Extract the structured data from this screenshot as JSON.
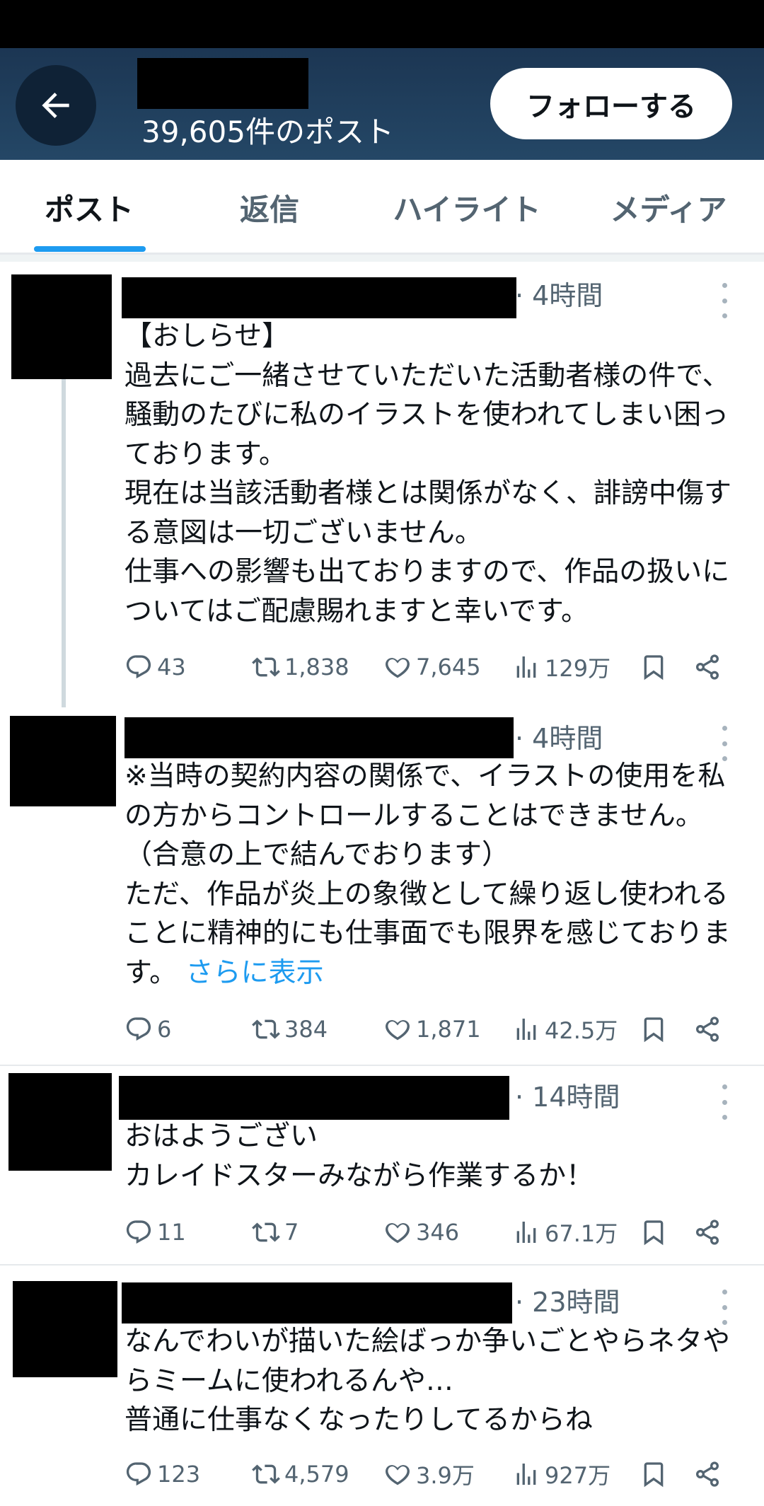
{
  "header": {
    "post_count": "39,605件のポスト",
    "follow_label": "フォローする",
    "back_icon": "arrow-left-icon"
  },
  "tabs": [
    {
      "label": "ポスト",
      "active": true
    },
    {
      "label": "返信",
      "active": false
    },
    {
      "label": "ハイライト",
      "active": false
    },
    {
      "label": "メディア",
      "active": false
    }
  ],
  "colors": {
    "header_bg": "#1c3653",
    "accent": "#1d9bf0",
    "muted": "#536471"
  },
  "posts": [
    {
      "time": "· 4時間",
      "text": "【おしらせ】\n過去にご一緒させていただいた活動者様の件で、騒動のたびに私のイラストを使われてしまい困っております。\n現在は当該活動者様とは関係がなく、誹謗中傷する意図は一切ございません。\n仕事への影響も出ておりますので、作品の扱いについてはご配慮賜れますと幸いです。",
      "show_more": "",
      "replies": "43",
      "reposts": "1,838",
      "likes": "7,645",
      "views": "129万"
    },
    {
      "time": "· 4時間",
      "text": "※当時の契約内容の関係で、イラストの使用を私の方からコントロールすることはできません。（合意の上で結んでおります）\nただ、作品が炎上の象徴として繰り返し使われることに精神的にも仕事面でも限界を感じております。",
      "show_more": "さらに表示",
      "replies": "6",
      "reposts": "384",
      "likes": "1,871",
      "views": "42.5万"
    },
    {
      "time": "· 14時間",
      "text": "おはようござい\nカレイドスターみながら作業するか！",
      "show_more": "",
      "replies": "11",
      "reposts": "7",
      "likes": "346",
      "views": "67.1万"
    },
    {
      "time": "· 23時間",
      "text": "なんでわいが描いた絵ばっか争いごとやらネタやらミームに使われるんや…\n普通に仕事なくなったりしてるからね",
      "show_more": "",
      "replies": "123",
      "reposts": "4,579",
      "likes": "3.9万",
      "views": "927万"
    }
  ]
}
